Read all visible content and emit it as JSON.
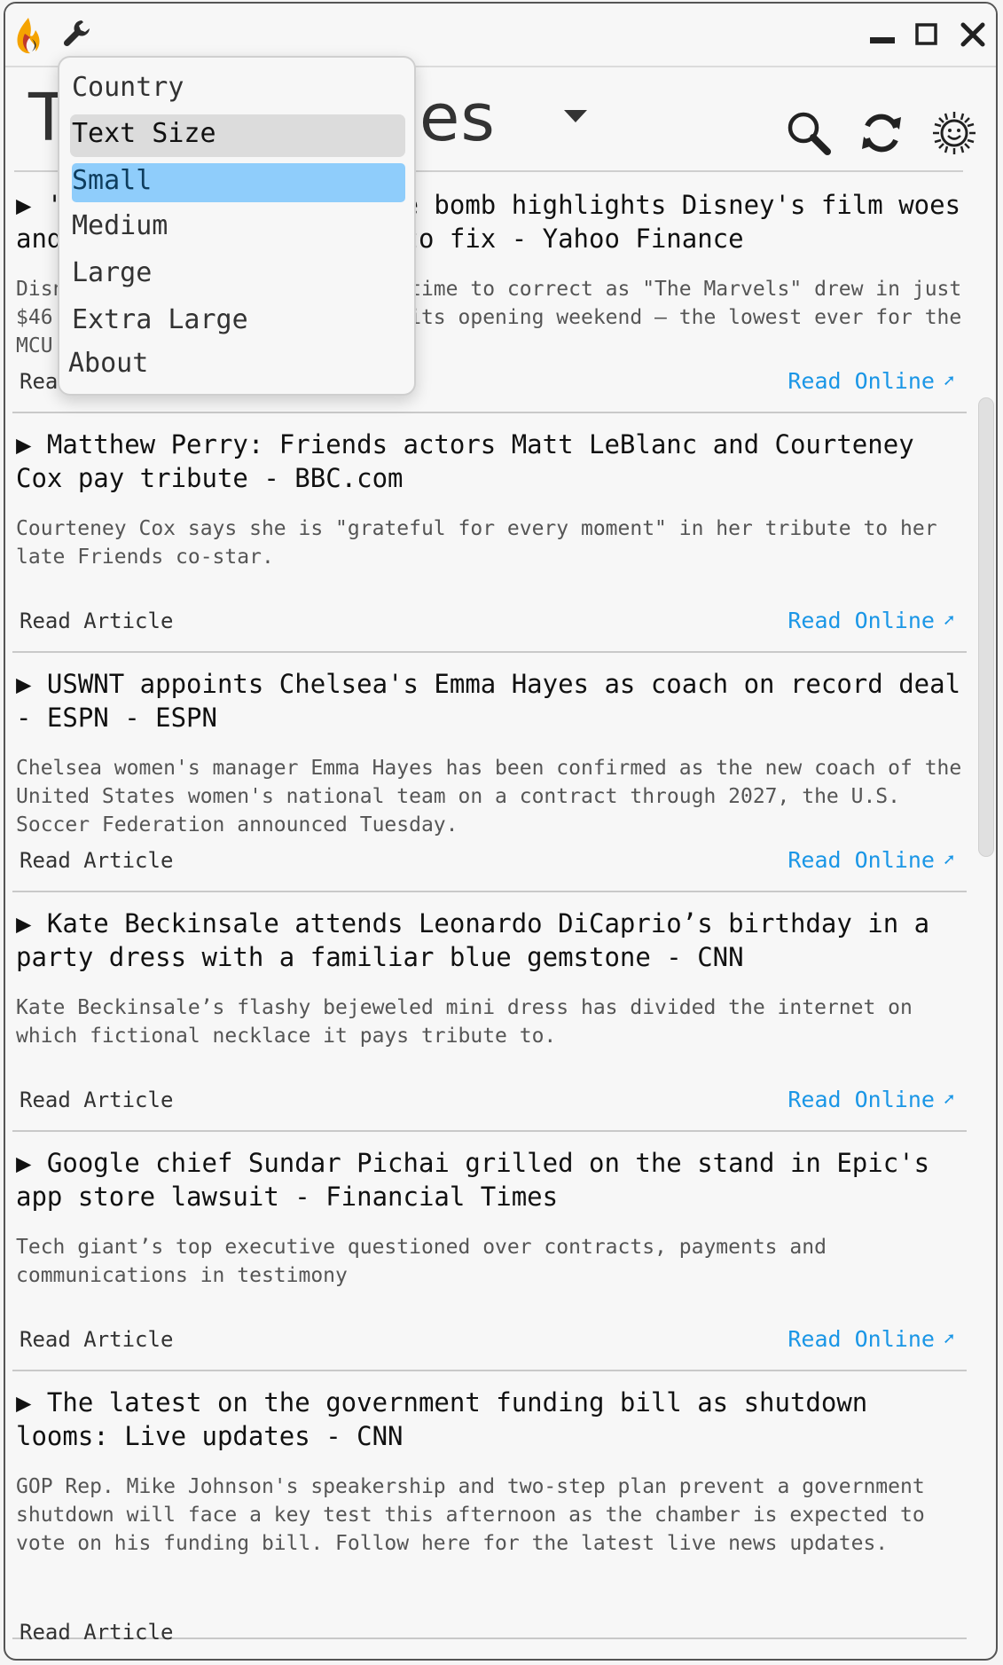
{
  "window": {
    "title": "Top Headlines",
    "icons": {
      "logo": "app-flame-logo-icon",
      "settings": "wrench-icon",
      "minimize": "minimize-icon",
      "maximize": "maximize-icon",
      "close": "close-icon",
      "search": "search-icon",
      "refresh": "refresh-icon",
      "theme": "sun-face-icon"
    }
  },
  "colors": {
    "accent": "#1a96e6",
    "selection": "#8fcdfb",
    "hover": "#dcdcdc"
  },
  "menu": {
    "items": [
      "Country",
      "Text Size",
      "Small",
      "Medium",
      "Large",
      "Extra Large",
      "About"
    ],
    "hovered": "Text Size",
    "selected": "Small"
  },
  "articles": [
    {
      "headline": "▶ 'The Marvels' box office bomb highlights Disney's film woes and how it'll take years to fix - Yahoo Finance",
      "summary": "Disney's movie studio will take time to correct as \"The Marvels\" drew in just $46 million domestically during its opening weekend — the lowest ever for the MCU.",
      "read_article": "Read Article",
      "read_online": "Read Online"
    },
    {
      "headline": "▶ Matthew Perry: Friends actors Matt LeBlanc and Courteney Cox pay tribute - BBC.com",
      "summary": "Courteney Cox says she is \"grateful for every moment\" in her tribute to her late Friends co-star.",
      "read_article": "Read Article",
      "read_online": "Read Online"
    },
    {
      "headline": "▶ USWNT appoints Chelsea's Emma Hayes as coach on record deal - ESPN - ESPN",
      "summary": "Chelsea women's manager Emma Hayes has been confirmed as the new coach of the United States women's national team on a contract through 2027, the U.S. Soccer Federation announced Tuesday.",
      "read_article": "Read Article",
      "read_online": "Read Online"
    },
    {
      "headline": "▶ Kate Beckinsale attends Leonardo DiCaprio’s birthday in a party dress with a familiar blue gemstone - CNN",
      "summary": "Kate Beckinsale’s flashy bejeweled mini dress has divided the internet on which fictional necklace it pays tribute to.",
      "read_article": "Read Article",
      "read_online": "Read Online"
    },
    {
      "headline": "▶ Google chief Sundar Pichai grilled on the stand in Epic's app store lawsuit - Financial Times",
      "summary": "Tech giant’s top executive questioned over contracts, payments and communications in testimony",
      "read_article": "Read Article",
      "read_online": "Read Online"
    },
    {
      "headline": "▶ The latest on the government funding bill as shutdown looms: Live updates - CNN",
      "summary": "GOP Rep. Mike Johnson's speakership and two-step plan prevent a government shutdown will face a key test this afternoon as the chamber is expected to vote on his funding bill. Follow here for the latest live news updates.",
      "read_article": "Read Article",
      "read_online": "Read Online"
    }
  ]
}
